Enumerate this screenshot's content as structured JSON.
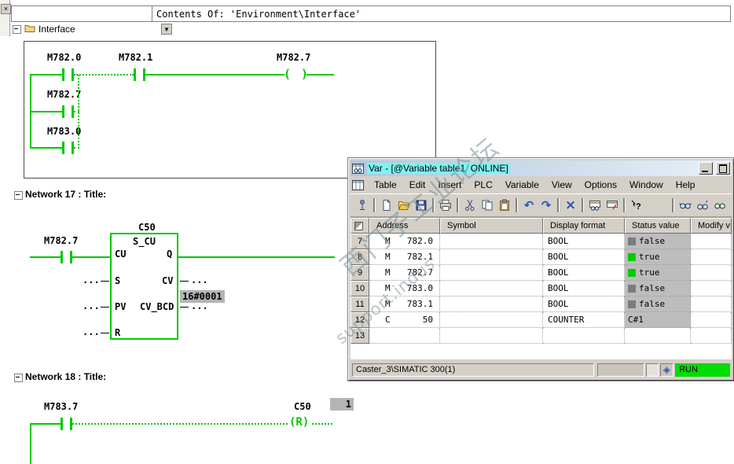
{
  "top": {
    "header_title": "Contents Of: 'Environment\\Interface'",
    "tree_item": "Interface"
  },
  "colors": {
    "status_true": "#00cc00",
    "status_false": "#7c7c7c",
    "ladder_green": "#00c800",
    "run_green": "#00dd00",
    "title_highlight": "#7ef4f0",
    "online_value_bg": "#b4b4b4"
  },
  "ladder": {
    "coil_symbol": "( )",
    "network_prev": {
      "contact1": "M782.0",
      "contact2": "M782.1",
      "coil": "M782.7",
      "branch1": "M782.7",
      "branch2": "M783.0"
    },
    "network17": {
      "title": "Network 17 : Title:",
      "contact": "M782.7",
      "block_address": "C50",
      "block_type": "S_CU",
      "pin_cu": "CU",
      "pin_q": "Q",
      "pin_s": "S",
      "pin_cv": "CV",
      "pin_pv": "PV",
      "pin_cv_bcd": "CV_BCD",
      "pin_r": "R",
      "cv_bcd_value": "16#0001",
      "placeholder": "..."
    },
    "network18": {
      "title": "Network 18 : Title:",
      "contact": "M783.7",
      "coil_address": "C50",
      "coil_text": "(R)",
      "counter_value": "1"
    }
  },
  "var_window": {
    "title": "Var - [@Variable table1  ONLINE]",
    "menus": [
      "Table",
      "Edit",
      "Insert",
      "PLC",
      "Variable",
      "View",
      "Options",
      "Window",
      "Help"
    ],
    "toolbar_icons": [
      "pin",
      "new",
      "open",
      "save",
      "print",
      "cut",
      "copy",
      "paste",
      "undo",
      "redo",
      "delete",
      "monitor-table",
      "modify-table",
      "help",
      "monitor-variables",
      "monitor-trigger",
      "modify-variables"
    ],
    "table": {
      "headers": [
        "Address",
        "Symbol",
        "Display format",
        "Status value",
        "Modify v"
      ],
      "rows": [
        {
          "num": "7",
          "area": "M",
          "addr": "782.0",
          "symbol": "",
          "format": "BOOL",
          "status": "false",
          "square": "gray"
        },
        {
          "num": "8",
          "area": "M",
          "addr": "782.1",
          "symbol": "",
          "format": "BOOL",
          "status": "true",
          "square": "green"
        },
        {
          "num": "9",
          "area": "M",
          "addr": "782.7",
          "symbol": "",
          "format": "BOOL",
          "status": "true",
          "square": "green"
        },
        {
          "num": "10",
          "area": "M",
          "addr": "783.0",
          "symbol": "",
          "format": "BOOL",
          "status": "false",
          "square": "gray"
        },
        {
          "num": "11",
          "area": "M",
          "addr": "783.1",
          "symbol": "",
          "format": "BOOL",
          "status": "false",
          "square": "gray"
        },
        {
          "num": "12",
          "area": "C",
          "addr": "50",
          "symbol": "",
          "format": "COUNTER",
          "status": "C#1",
          "square": ""
        },
        {
          "num": "13",
          "area": "",
          "addr": "",
          "symbol": "",
          "format": "",
          "status": "",
          "square": ""
        }
      ]
    },
    "statusbar": {
      "path": "Caster_3\\SIMATIC 300(1)",
      "mode": "RUN"
    }
  },
  "watermark": {
    "line1": "西门子工业论坛",
    "line2": "support.indus"
  }
}
